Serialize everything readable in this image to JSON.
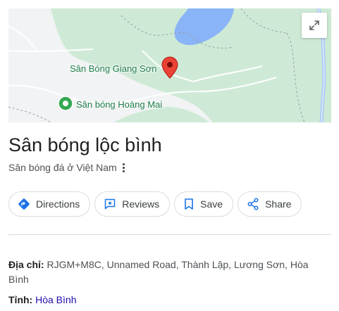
{
  "map": {
    "places": [
      {
        "name": "Sân Bóng Giang Sơn",
        "pin": "red-pin-icon"
      },
      {
        "name": "Sân bóng Hoàng Mai",
        "pin": "green-pin-icon"
      }
    ],
    "expand_icon": "expand-icon"
  },
  "place": {
    "title": "Sân bóng lộc bình",
    "category": "Sân bóng đá ở Việt Nam"
  },
  "actions": {
    "directions": "Directions",
    "reviews": "Reviews",
    "save": "Save",
    "share": "Share"
  },
  "info": {
    "address_label": "Địa chỉ:",
    "address_value": "RJGM+M8C, Unnamed Road, Thành Lập, Lương Sơn, Hòa Bình",
    "province_label": "Tỉnh:",
    "province_value": "Hòa Bình"
  },
  "colors": {
    "park_green": "#ceead6",
    "water_blue": "#8ab4f8",
    "pin_red": "#ea4335",
    "pin_green": "#34a853",
    "accent_blue": "#1a73e8",
    "link": "#1a0dab"
  }
}
